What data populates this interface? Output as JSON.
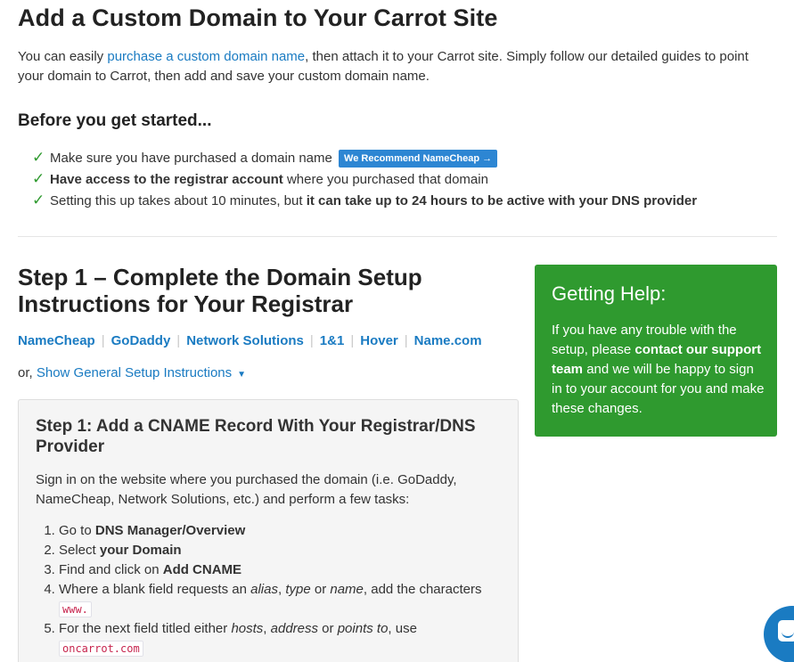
{
  "header": {
    "title": "Add a Custom Domain to Your Carrot Site",
    "intro_pre": "You can easily ",
    "intro_link": "purchase a custom domain name",
    "intro_post": ", then attach it to your Carrot site. Simply follow our detailed guides to point your domain to Carrot, then add and save your custom domain name."
  },
  "before": {
    "title": "Before you get started...",
    "item1": "Make sure you have purchased a domain name",
    "badge": "We Recommend NameCheap →",
    "item2_bold": "Have access to the registrar account",
    "item2_rest": " where you purchased that domain",
    "item3_pre": "Setting this up takes about 10 minutes, but ",
    "item3_bold": "it can take up to 24 hours to be active with your DNS provider"
  },
  "step1": {
    "title": "Step 1 – Complete the Domain Setup Instructions for Your Registrar",
    "registrars": [
      "NameCheap",
      "GoDaddy",
      "Network Solutions",
      "1&1",
      "Hover",
      "Name.com"
    ],
    "or_text": "or, ",
    "general_link": "Show General Setup Instructions",
    "caret": "▼"
  },
  "card": {
    "title": "Step 1: Add a CNAME Record With Your Registrar/DNS Provider",
    "intro": "Sign in on the website where you purchased the domain (i.e. GoDaddy, NameCheap, Network Solutions, etc.) and perform a few tasks:",
    "s1_pre": "Go to ",
    "s1_bold": "DNS Manager/Overview",
    "s2_pre": "Select ",
    "s2_bold": "your Domain",
    "s3_pre": "Find and click on ",
    "s3_bold": "Add CNAME",
    "s4_pre": "Where a blank field requests an ",
    "s4_i1": "alias",
    "s4_c1": ", ",
    "s4_i2": "type",
    "s4_c2": " or ",
    "s4_i3": "name",
    "s4_post": ", add the characters ",
    "s4_code": "www.",
    "s5_pre": "For the next field titled either ",
    "s5_i1": "hosts",
    "s5_c1": ", ",
    "s5_i2": "address",
    "s5_c2": " or ",
    "s5_i3": "points to",
    "s5_post": ", use ",
    "s5_code": "oncarrot.com"
  },
  "help": {
    "title": "Getting Help:",
    "pre": "If you have any trouble with the setup, please ",
    "link": "contact our support team",
    "post": " and we will be happy to sign in to your account for you and make these changes."
  },
  "colors": {
    "link": "#1a7bc2",
    "check": "#2f9a2f",
    "help_bg": "#2f9a2f",
    "badge_bg": "#2d86d3",
    "code": "#c7254e"
  },
  "icons": {
    "check": "✓",
    "chat": "chat-bubble-icon"
  }
}
